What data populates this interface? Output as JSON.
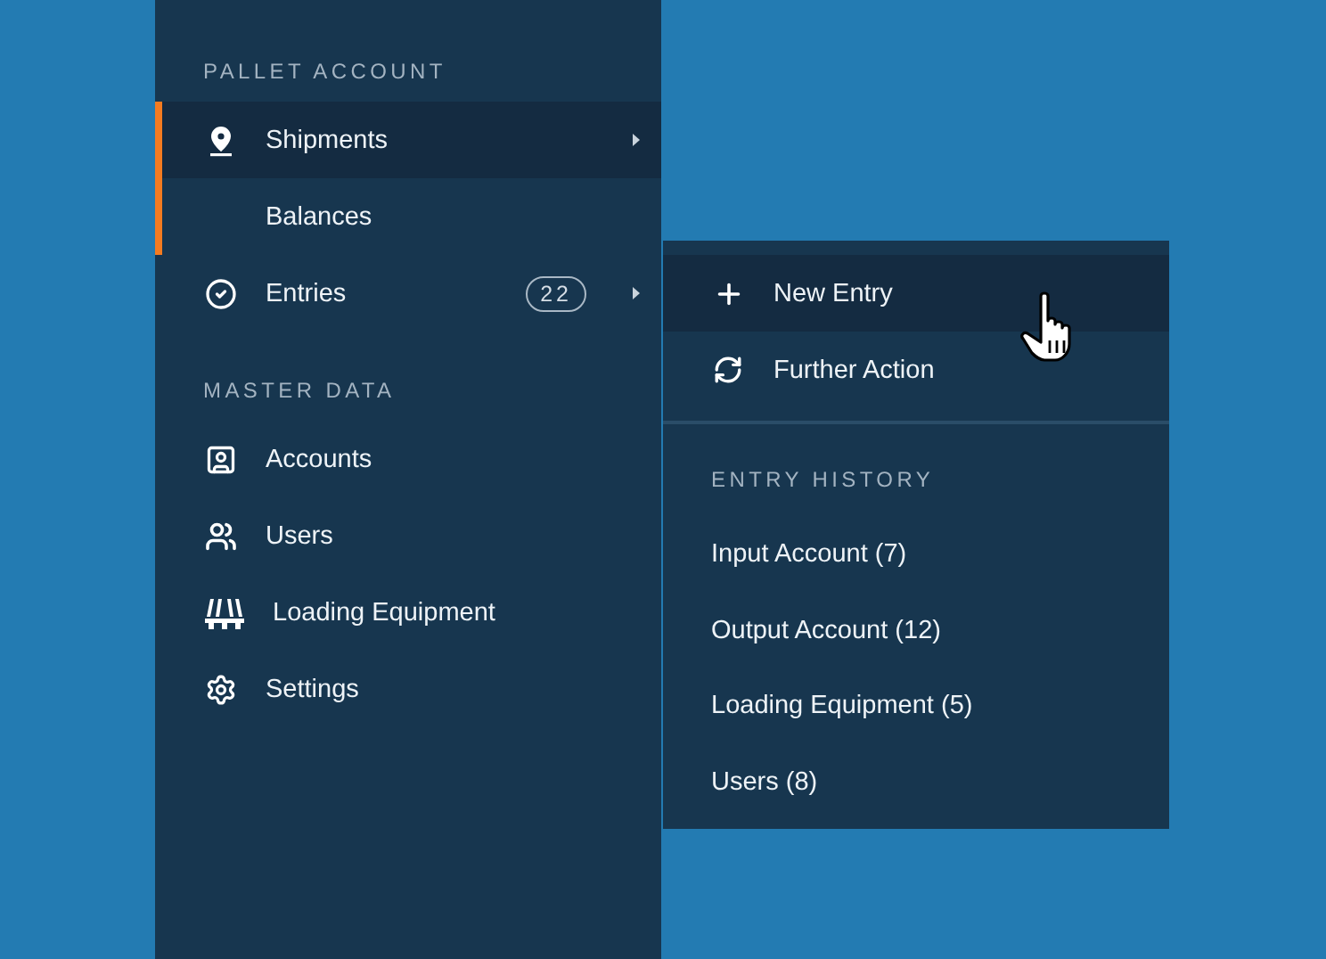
{
  "sidebar": {
    "sections": [
      {
        "title": "PALLET ACCOUNT",
        "items": [
          {
            "label": "Shipments",
            "kind": "pin",
            "selected": true,
            "active": true,
            "submenu": true
          },
          {
            "label": "Balances",
            "kind": "subitem",
            "selected": false,
            "active": true,
            "submenu": false
          },
          {
            "label": "Entries",
            "kind": "check",
            "selected": false,
            "active": false,
            "badge": "22",
            "submenu": true
          }
        ]
      },
      {
        "title": "MASTER DATA",
        "items": [
          {
            "label": "Accounts",
            "kind": "contact",
            "selected": false,
            "active": false,
            "submenu": false
          },
          {
            "label": "Users",
            "kind": "users",
            "selected": false,
            "active": false,
            "submenu": false
          },
          {
            "label": "Loading Equipment",
            "kind": "pallet",
            "selected": false,
            "active": false,
            "submenu": false
          },
          {
            "label": "Settings",
            "kind": "gear",
            "selected": false,
            "active": false,
            "submenu": false
          }
        ]
      }
    ]
  },
  "submenu": {
    "actions": [
      {
        "label": "New Entry",
        "kind": "plus",
        "hovered": true
      },
      {
        "label": "Further Action",
        "kind": "refresh",
        "hovered": false
      }
    ],
    "history_title": "ENTRY HISTORY",
    "history": [
      "Input Account (7)",
      "Output Account (12)",
      "Loading Equipment (5)",
      "Users (8)"
    ]
  }
}
